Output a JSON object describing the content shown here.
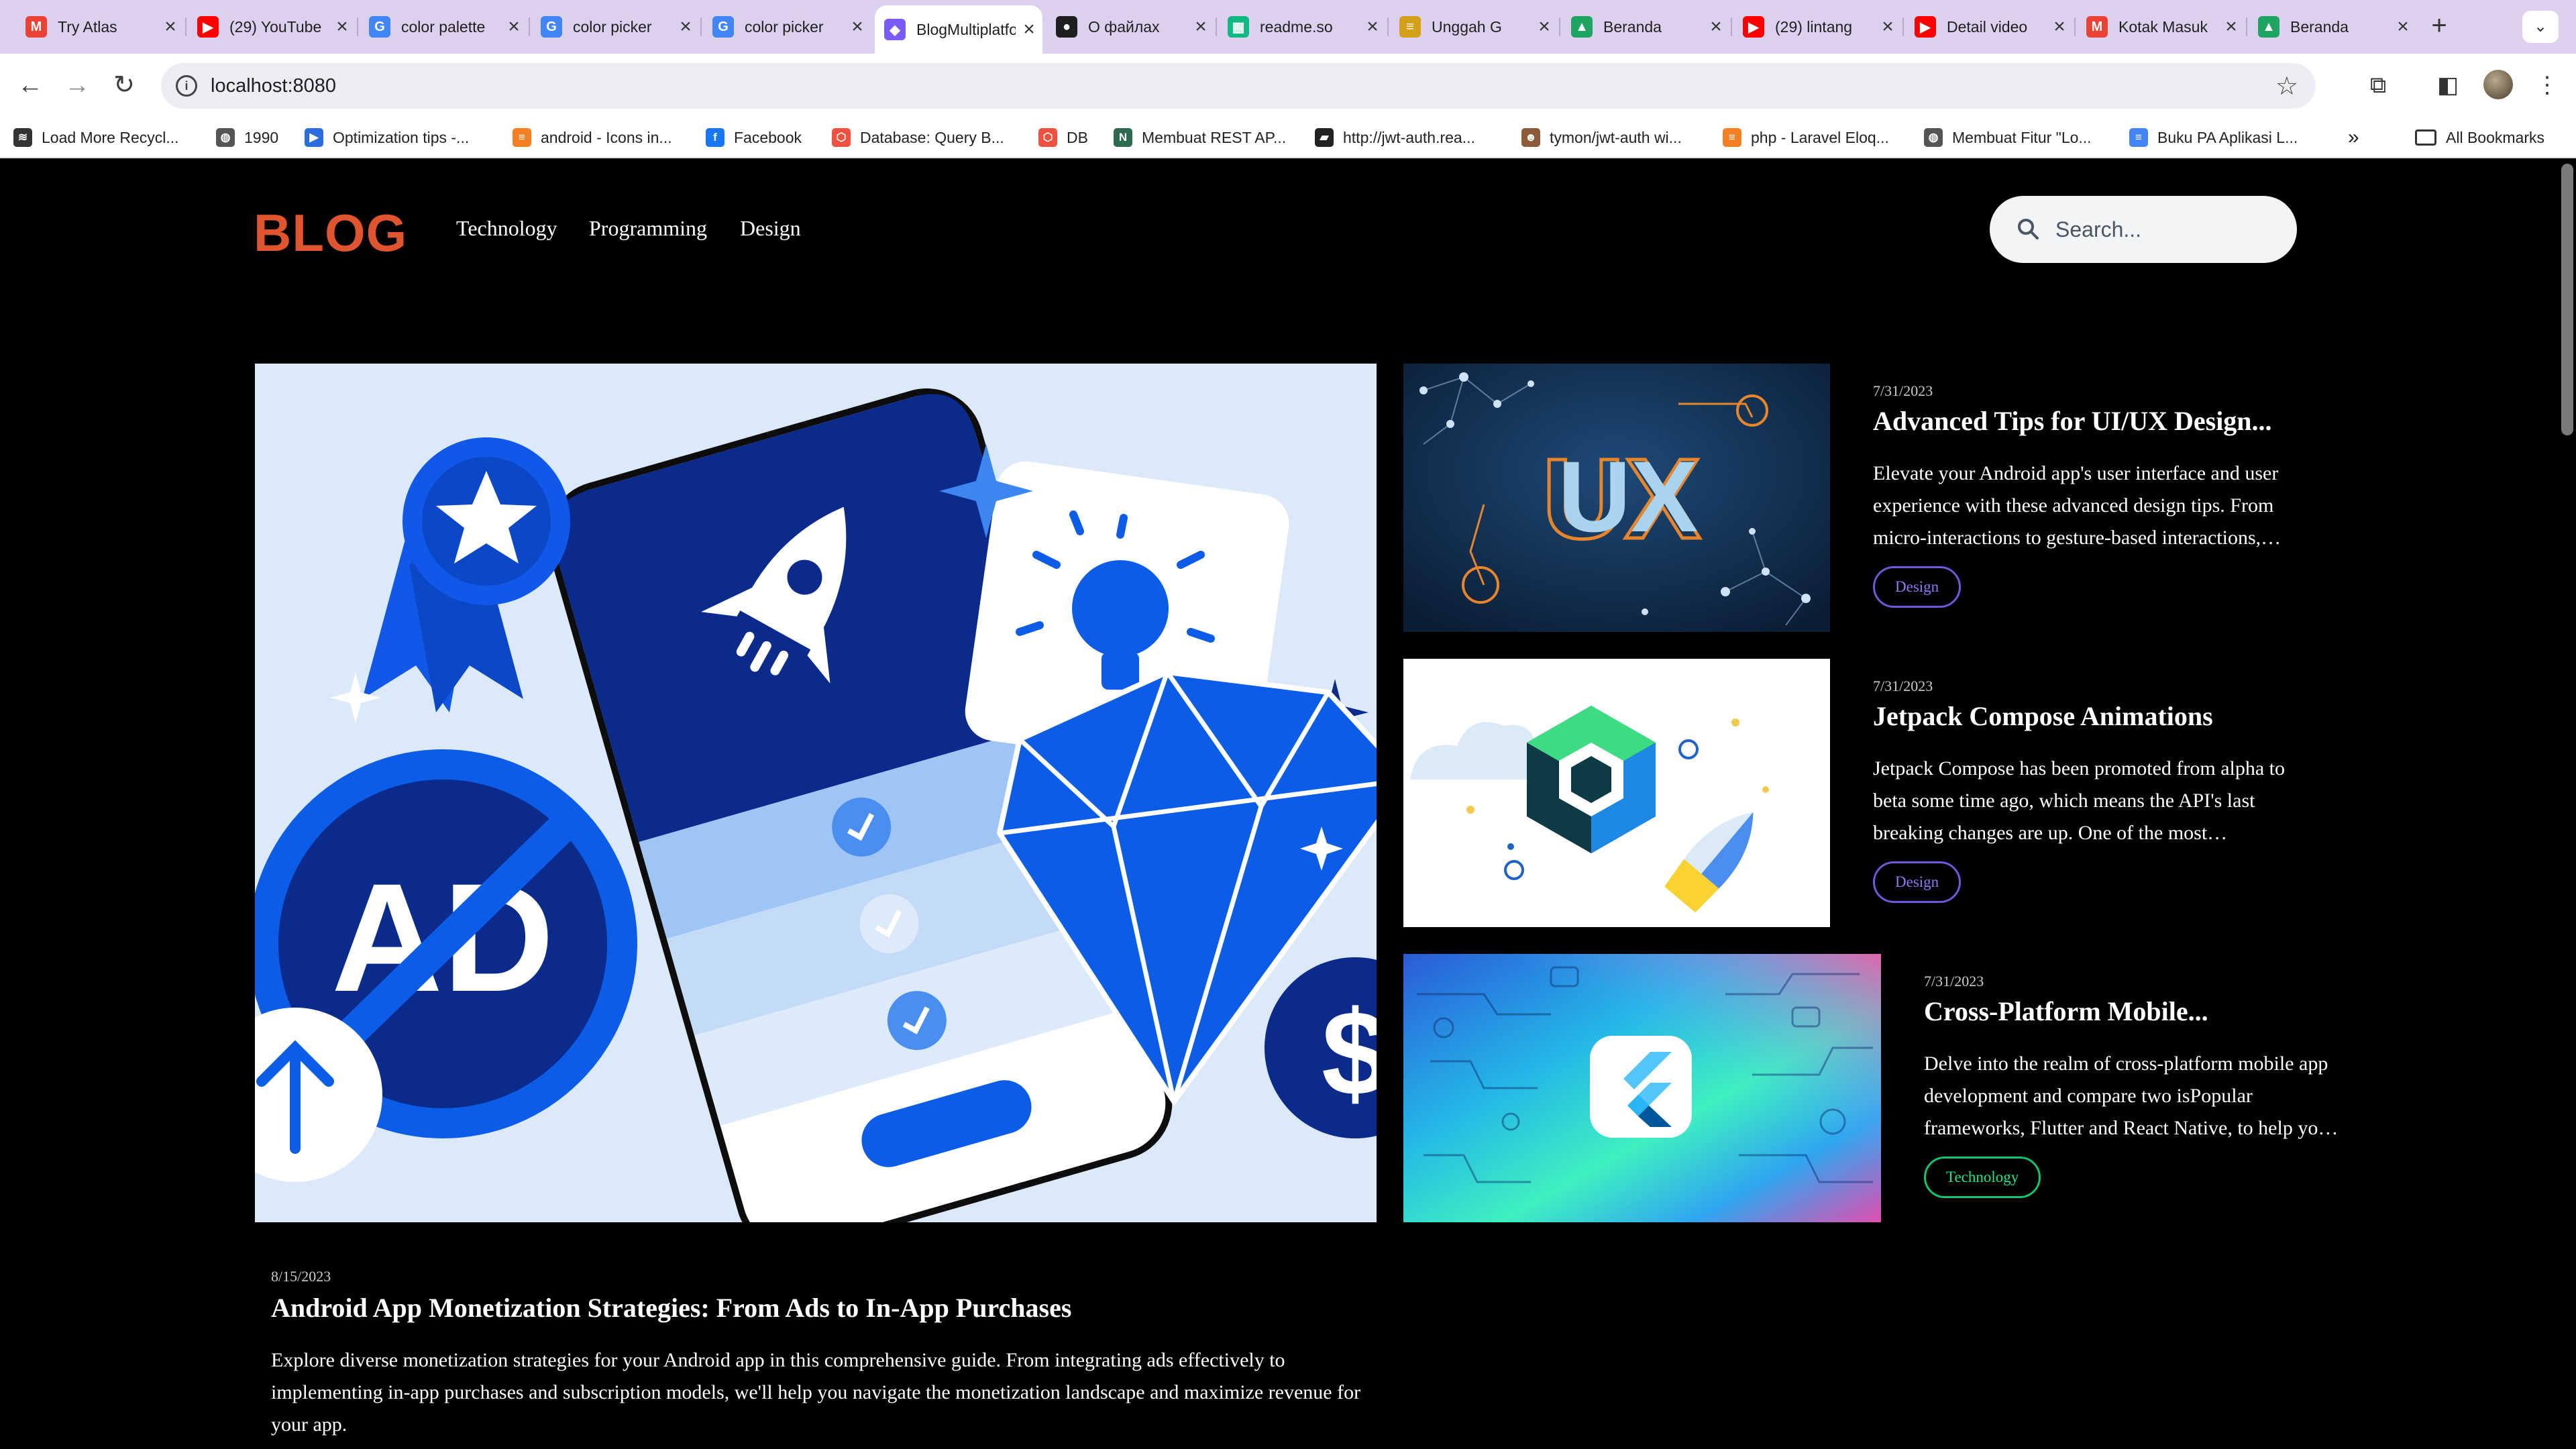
{
  "browser": {
    "tabs": [
      {
        "title": "Try Atlas",
        "icon": "gmail-icon",
        "color": "#ea4335",
        "glyph": "M"
      },
      {
        "title": "(29) YouTube",
        "icon": "youtube-icon",
        "color": "#ff0000",
        "glyph": "▶"
      },
      {
        "title": "color palette",
        "icon": "google-icon",
        "color": "#4285f4",
        "glyph": "G"
      },
      {
        "title": "color picker",
        "icon": "google-icon",
        "color": "#4285f4",
        "glyph": "G"
      },
      {
        "title": "color picker",
        "icon": "google-icon",
        "color": "#4285f4",
        "glyph": "G"
      },
      {
        "title": "BlogMultiplatform",
        "icon": "blog-favicon-icon",
        "color": "#7a5af8",
        "glyph": "◆"
      },
      {
        "title": "О файлах",
        "icon": "github-icon",
        "color": "#1f1f1f",
        "glyph": "●"
      },
      {
        "title": "readme.so",
        "icon": "readme-icon",
        "color": "#10b981",
        "glyph": "▦"
      },
      {
        "title": "Unggah G",
        "icon": "upload-icon",
        "color": "#d4a017",
        "glyph": "≡"
      },
      {
        "title": "Beranda",
        "icon": "google-drive-icon",
        "color": "#1fa463",
        "glyph": "▲"
      },
      {
        "title": "(29) lintang",
        "icon": "youtube-icon",
        "color": "#ff0000",
        "glyph": "▶"
      },
      {
        "title": "Detail video",
        "icon": "youtube-icon",
        "color": "#ff0000",
        "glyph": "▶"
      },
      {
        "title": "Kotak Masuk",
        "icon": "gmail-icon",
        "color": "#ea4335",
        "glyph": "M"
      },
      {
        "title": "Beranda",
        "icon": "google-drive-icon",
        "color": "#1fa463",
        "glyph": "▲"
      }
    ],
    "active_tab_index": 5,
    "url": "localhost:8080",
    "bookmarks": [
      {
        "label": "Load More Recycl...",
        "icon": "bookmark-favicon-icon",
        "color": "#333333",
        "glyph": "≋"
      },
      {
        "label": "1990",
        "icon": "globe-icon",
        "color": "#555555",
        "glyph": "◍"
      },
      {
        "label": "Optimization tips -...",
        "icon": "flutter-icon",
        "color": "#2b6cdf",
        "glyph": "▶"
      },
      {
        "label": "android - Icons in...",
        "icon": "stackoverflow-icon",
        "color": "#f48024",
        "glyph": "≡"
      },
      {
        "label": "Facebook",
        "icon": "facebook-icon",
        "color": "#1877f2",
        "glyph": "f"
      },
      {
        "label": "Database: Query B...",
        "icon": "laravel-icon",
        "color": "#f0513f",
        "glyph": "⬡"
      },
      {
        "label": "DB",
        "icon": "laravel-icon",
        "color": "#f0513f",
        "glyph": "⬡"
      },
      {
        "label": "Membuat REST AP...",
        "icon": "nc-icon",
        "color": "#2d6a4f",
        "glyph": "N"
      },
      {
        "label": "http://jwt-auth.rea...",
        "icon": "book-icon",
        "color": "#222222",
        "glyph": "▰"
      },
      {
        "label": "tymon/jwt-auth wi...",
        "icon": "avatar-icon",
        "color": "#8d5b3a",
        "glyph": "☻"
      },
      {
        "label": "php - Laravel Eloq...",
        "icon": "stackoverflow-icon",
        "color": "#f48024",
        "glyph": "≡"
      },
      {
        "label": "Membuat Fitur \"Lo...",
        "icon": "globe-icon",
        "color": "#555555",
        "glyph": "◍"
      },
      {
        "label": "Buku PA Aplikasi L...",
        "icon": "google-docs-icon",
        "color": "#4285f4",
        "glyph": "≡"
      }
    ],
    "all_bookmarks_label": "All Bookmarks"
  },
  "site": {
    "logo": "BLOG",
    "nav": [
      "Technology",
      "Programming",
      "Design"
    ],
    "search_placeholder": "Search..."
  },
  "hero_post": {
    "date": "8/15/2023",
    "title": "Android App Monetization Strategies: From Ads to In-App Purchases",
    "excerpt": "Explore diverse monetization strategies for your Android app in this comprehensive guide. From integrating ads effectively to implementing in-app purchases and subscription models, we'll help you navigate the monetization landscape and maximize revenue for your app."
  },
  "side_posts": [
    {
      "date": "7/31/2023",
      "title": "Advanced Tips for UI/UX Design...",
      "excerpt": "Elevate your Android app's user interface and user experience with these advanced design tips. From micro-interactions to gesture-based interactions, we've got you covered.",
      "tag": "Design",
      "image_text": "UX"
    },
    {
      "date": "7/31/2023",
      "title": "Jetpack Compose Animations",
      "excerpt": "Jetpack Compose has been promoted from alpha to beta some time ago, which means the API's last breaking changes are up. One of the most important things is animations.",
      "tag": "Design"
    },
    {
      "date": "7/31/2023",
      "title": "Cross-Platform Mobile...",
      "excerpt": "Delve into the realm of cross-platform mobile app development and compare two isPopular frameworks, Flutter and React Native, to help you choose.",
      "tag": "Technology"
    }
  ],
  "colors": {
    "logo": "#e0542e",
    "design_tag": "#8b7cf6",
    "technology_tag": "#22e38a"
  }
}
